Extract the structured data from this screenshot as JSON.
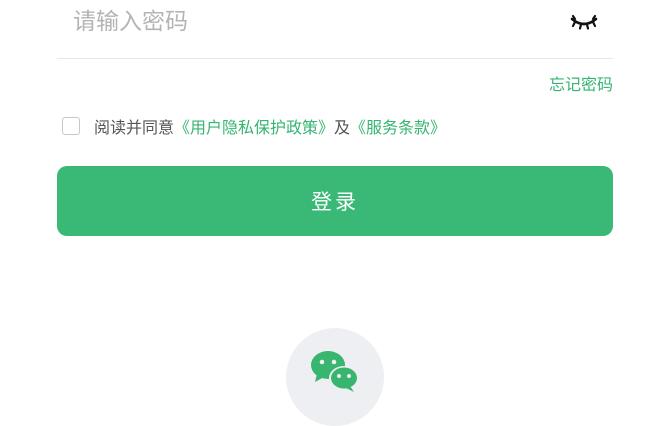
{
  "password": {
    "placeholder": "请输入密码",
    "value": "",
    "toggle_icon": "eye-closed-icon"
  },
  "forgot_password_label": "忘记密码",
  "agreement": {
    "checked": false,
    "text_prefix": "阅读并同意",
    "privacy_link": "《用户隐私保护政策》",
    "connector": "及",
    "terms_link": "《服务条款》"
  },
  "login_button_label": "登录",
  "third_party": {
    "icon": "wechat-icon"
  },
  "colors": {
    "accent": "#36b472",
    "button": "#3ab976",
    "wechat_circle": "#eeeff2"
  }
}
